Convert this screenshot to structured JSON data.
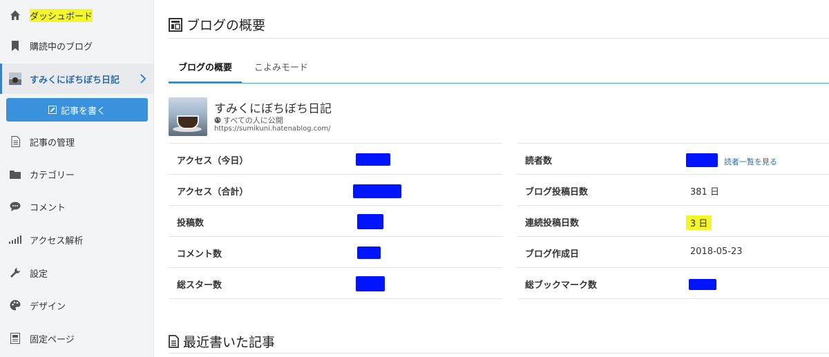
{
  "sidebar": {
    "items": [
      {
        "label": "ダッシュボード",
        "icon": "home-icon"
      },
      {
        "label": "購読中のブログ",
        "icon": "bookmark-icon"
      },
      {
        "label": "すみくにぼちぼち日記",
        "icon": "blog-avatar-icon"
      },
      {
        "label": "記事の管理",
        "icon": "document-icon"
      },
      {
        "label": "カテゴリー",
        "icon": "folder-icon"
      },
      {
        "label": "コメント",
        "icon": "comment-icon"
      },
      {
        "label": "アクセス解析",
        "icon": "bar-signal-icon"
      },
      {
        "label": "設定",
        "icon": "wrench-icon"
      },
      {
        "label": "デザイン",
        "icon": "palette-icon"
      },
      {
        "label": "固定ページ",
        "icon": "page-icon"
      }
    ],
    "write_button": "記事を書く"
  },
  "main": {
    "title": "ブログの概要",
    "tabs": [
      "ブログの概要",
      "こよみモード"
    ],
    "blog": {
      "name": "すみくにぼちぼち日記",
      "visibility": "すべての人に公開",
      "url": "https://sumikuni.hatenablog.com/"
    },
    "stats_left": [
      {
        "label": "アクセス（今日）"
      },
      {
        "label": "アクセス（合計）"
      },
      {
        "label": "投稿数"
      },
      {
        "label": "コメント数"
      },
      {
        "label": "総スター数"
      }
    ],
    "stats_right": [
      {
        "label": "読者数",
        "link": "読者一覧を見る"
      },
      {
        "label": "ブログ投稿日数",
        "value": "381 日"
      },
      {
        "label": "連続投稿日数",
        "value": "3 日"
      },
      {
        "label": "ブログ作成日",
        "value": "2018-05-23"
      },
      {
        "label": "総ブックマーク数"
      }
    ],
    "recent_title": "最近書いた記事"
  },
  "colors": {
    "accent": "#3a92dc",
    "highlight": "#f4f62c",
    "redaction": "#0014ff"
  }
}
